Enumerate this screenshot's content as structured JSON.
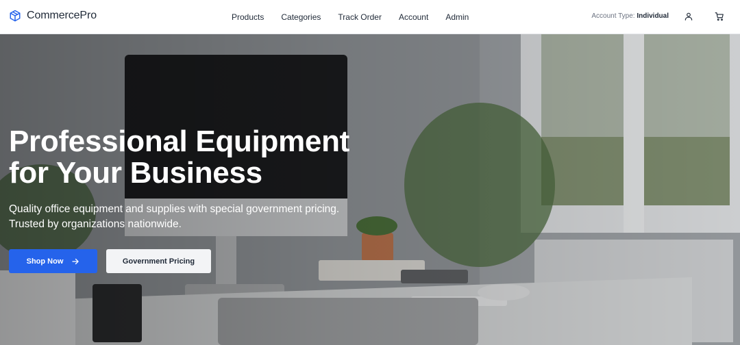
{
  "header": {
    "brand": "CommercePro",
    "nav": [
      "Products",
      "Categories",
      "Track Order",
      "Account",
      "Admin"
    ],
    "account_type_label": "Account Type:",
    "account_type_value": "Individual",
    "icons": [
      "user-icon",
      "cart-icon"
    ]
  },
  "hero": {
    "headline_line1": "Professional Equipment",
    "headline_line2": "for Your Business",
    "subtext_line1": "Quality office equipment and supplies with special government pricing.",
    "subtext_line2": "Trusted by organizations nationwide.",
    "primary_button": "Shop Now",
    "secondary_button": "Government Pricing"
  },
  "colors": {
    "accent": "#2563eb",
    "header_bg": "#ffffff",
    "secondary_button_bg": "#f3f4f6"
  }
}
